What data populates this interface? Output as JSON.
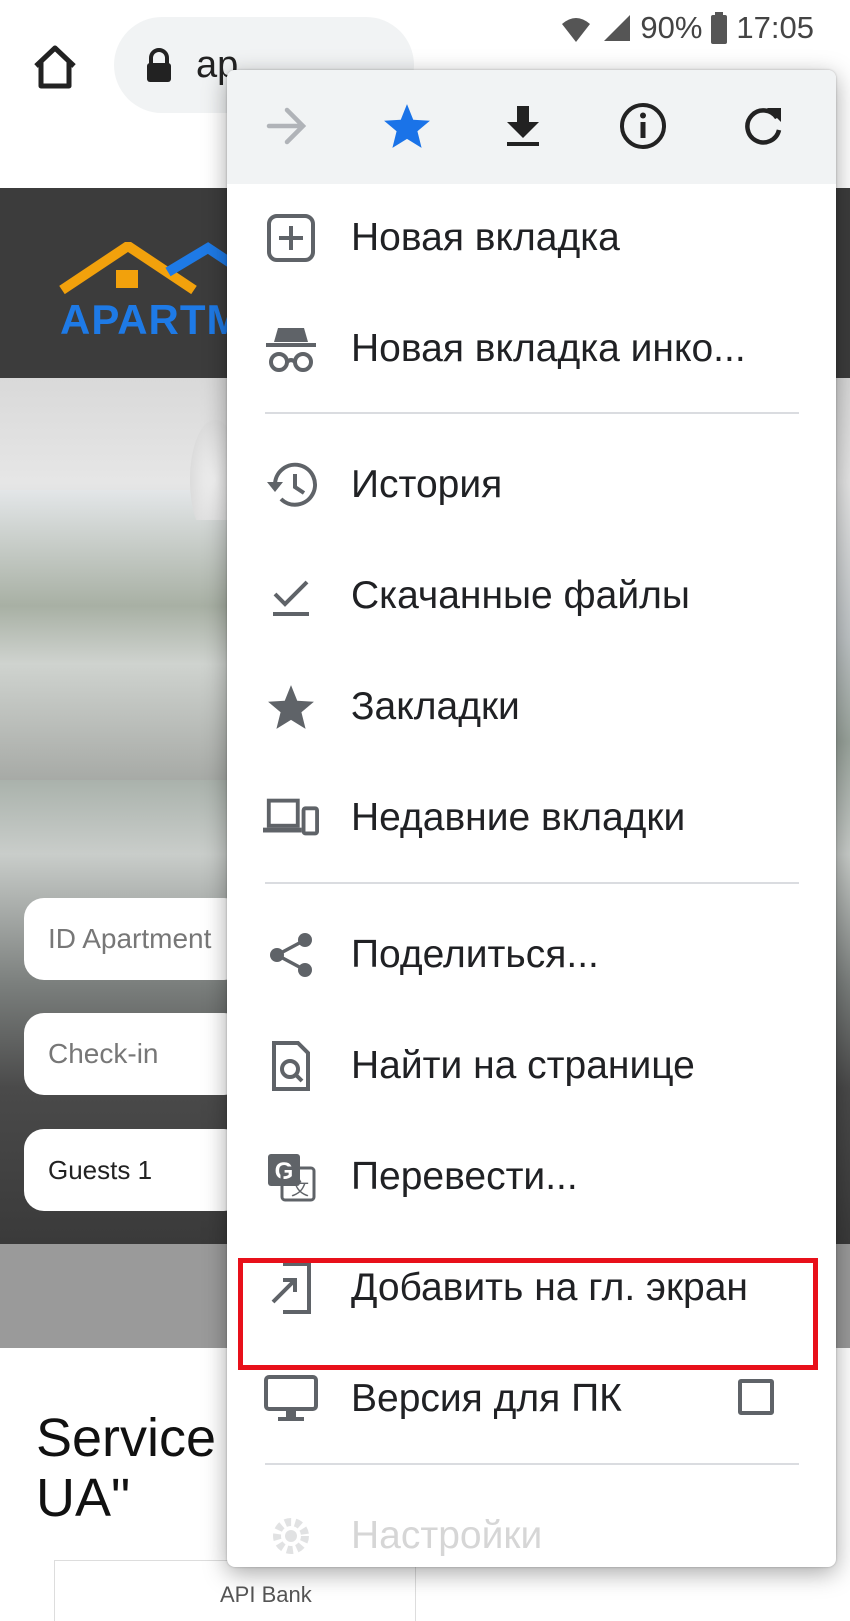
{
  "status_bar": {
    "battery": "90%",
    "time": "17:05"
  },
  "browser": {
    "url_fragment": "ap"
  },
  "page": {
    "logo_text": "APARTM",
    "fields": [
      {
        "text": "ID Apartment"
      },
      {
        "text": "Check-in"
      },
      {
        "text": "Guests 1"
      }
    ],
    "service_title_line1": "Service",
    "service_title_line2": "UA\"",
    "bank_text": "API Bank"
  },
  "menu": {
    "iconbar": [
      {
        "name": "forward-icon"
      },
      {
        "name": "bookmark-star-icon"
      },
      {
        "name": "download-icon"
      },
      {
        "name": "info-icon"
      },
      {
        "name": "reload-icon"
      }
    ],
    "items": [
      {
        "label": "Новая вкладка",
        "icon": "new-tab-icon"
      },
      {
        "label": "Новая вкладка инко...",
        "icon": "incognito-icon"
      },
      {
        "label": "История",
        "icon": "history-icon"
      },
      {
        "label": "Скачанные файлы",
        "icon": "downloads-icon"
      },
      {
        "label": "Закладки",
        "icon": "bookmarks-star-icon"
      },
      {
        "label": "Недавние вкладки",
        "icon": "recent-tabs-icon"
      },
      {
        "label": "Поделиться...",
        "icon": "share-icon"
      },
      {
        "label": "Найти на странице",
        "icon": "find-in-page-icon"
      },
      {
        "label": "Перевести...",
        "icon": "translate-icon"
      },
      {
        "label": "Добавить на гл. экран",
        "icon": "add-to-home-icon"
      },
      {
        "label": "Версия для ПК",
        "icon": "desktop-icon",
        "checked": false
      },
      {
        "label": "Настройки",
        "icon": "settings-icon"
      }
    ]
  },
  "colors": {
    "accent_blue": "#1a73e8",
    "highlight_red": "#e8101a",
    "icon_gray": "#5f6368"
  }
}
